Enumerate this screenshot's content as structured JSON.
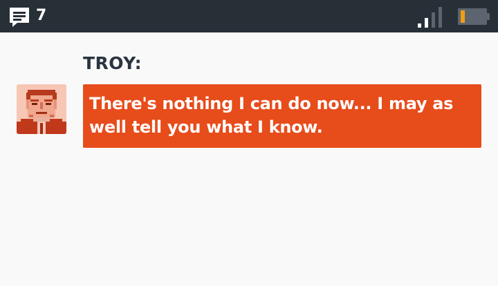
{
  "status_bar": {
    "message_count": "7",
    "message_icon": "message-icon",
    "signal_icon": "signal-strength-icon",
    "battery_icon": "battery-low-icon",
    "battery_level": 0.15
  },
  "dialogue": {
    "speaker": "TROY:",
    "text": "There's nothing I can do now... I may as well tell you what I know.",
    "avatar": "troy-portrait"
  },
  "colors": {
    "status_bar_bg": "#272f37",
    "bubble_bg": "#e74c1b",
    "page_bg": "#f9f9f9",
    "speaker_text": "#2b3440",
    "battery_level_color": "#f39c12"
  }
}
